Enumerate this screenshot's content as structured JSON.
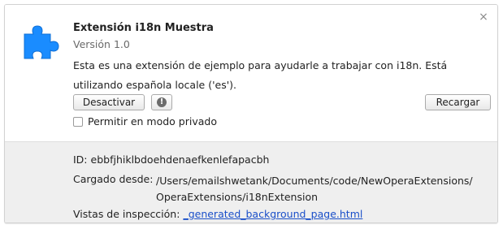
{
  "extension": {
    "name": "Extensión i18n Muestra",
    "version": "Versión 1.0",
    "description": "Esta es una extensión de ejemplo para ayudarle a trabajar con i18n. Está utilizando española locale ('es').",
    "icon": "puzzle-piece-icon",
    "accent_color": "#1a8cff"
  },
  "actions": {
    "close_symbol": "×",
    "disable_label": "Desactivar",
    "info_symbol": "!",
    "reload_label": "Recargar",
    "private_mode_label": "Permitir en modo privado",
    "private_mode_checked": false
  },
  "details": {
    "id_label": "ID:",
    "id_value": "ebbfjhiklbdoehdenaefkenlefapacbh",
    "loaded_label": "Cargado desde:",
    "loaded_path_line1": "/Users/emailshwetank/Documents/code/NewOperaExtensions/",
    "loaded_path_line2": "OperaExtensions/i18nExtension",
    "inspect_label": "Vistas de inspección:",
    "inspect_link": "_generated_background_page.html",
    "link_color": "#1a4fc9"
  }
}
